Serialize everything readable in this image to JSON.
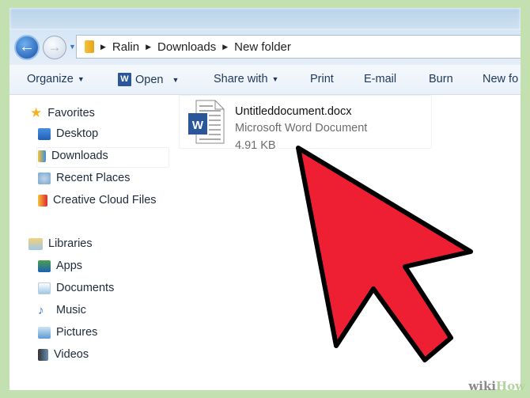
{
  "address_bar": {
    "path": [
      "Ralin",
      "Downloads",
      "New folder"
    ]
  },
  "toolbar": {
    "organize": "Organize",
    "open": "Open",
    "share_with": "Share with",
    "print": "Print",
    "email": "E-mail",
    "burn": "Burn",
    "new_folder": "New fo"
  },
  "sidebar": {
    "favorites": {
      "label": "Favorites",
      "items": [
        {
          "label": "Desktop"
        },
        {
          "label": "Downloads"
        },
        {
          "label": "Recent Places"
        },
        {
          "label": "Creative Cloud Files"
        }
      ]
    },
    "libraries": {
      "label": "Libraries",
      "items": [
        {
          "label": "Apps"
        },
        {
          "label": "Documents"
        },
        {
          "label": "Music"
        },
        {
          "label": "Pictures"
        },
        {
          "label": "Videos"
        }
      ]
    }
  },
  "file": {
    "name": "Untitleddocument.docx",
    "type": "Microsoft Word Document",
    "size": "4.91 KB",
    "icon": "word-document-icon"
  },
  "watermark": {
    "part1": "wiki",
    "part2": "How"
  },
  "colors": {
    "arrow": "#ee1f33",
    "border": "#c3e0b1",
    "word": "#2b579a"
  }
}
